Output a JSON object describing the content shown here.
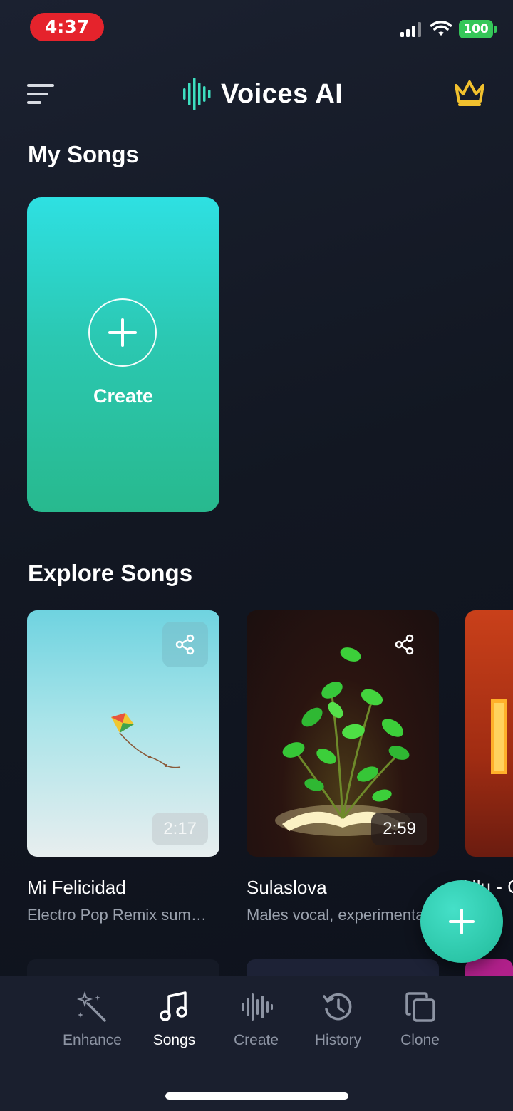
{
  "status_bar": {
    "time": "4:37",
    "battery": "100",
    "icons": [
      "signal-icon",
      "wifi-icon",
      "battery-icon"
    ]
  },
  "header": {
    "app_name": "Voices AI",
    "icons": [
      "menu-icon",
      "brand-waveform-icon",
      "crown-icon"
    ]
  },
  "my_songs": {
    "title": "My Songs",
    "create_card": {
      "label": "Create",
      "icon": "plus-icon"
    }
  },
  "explore": {
    "title": "Explore Songs",
    "songs": [
      {
        "title": "Mi Felicidad",
        "description": "Electro Pop Remix summer vibes",
        "duration": "2:17",
        "thumbnail": "kite-in-sky",
        "share_icon": "share-icon"
      },
      {
        "title": "Sulaslova",
        "description": "Males vocal, experimental",
        "duration": "2:59",
        "thumbnail": "plant-growing-from-book",
        "share_icon": "share-icon"
      },
      {
        "title": "Ulu - C",
        "thumbnail": "orange-room"
      }
    ]
  },
  "fab": {
    "icon": "plus-icon"
  },
  "bottom_nav": {
    "items": [
      {
        "label": "Enhance",
        "icon": "magic-wand-icon",
        "active": false
      },
      {
        "label": "Songs",
        "icon": "music-note-icon",
        "active": true
      },
      {
        "label": "Create",
        "icon": "waveform-icon",
        "active": false
      },
      {
        "label": "History",
        "icon": "history-icon",
        "active": false
      },
      {
        "label": "Clone",
        "icon": "copy-icon",
        "active": false
      }
    ]
  },
  "colors": {
    "accent": "#2cc6a8",
    "crown": "#f2c12e",
    "status_time": "#e5232c",
    "battery": "#35c759",
    "nav_inactive": "#8d94a3"
  }
}
